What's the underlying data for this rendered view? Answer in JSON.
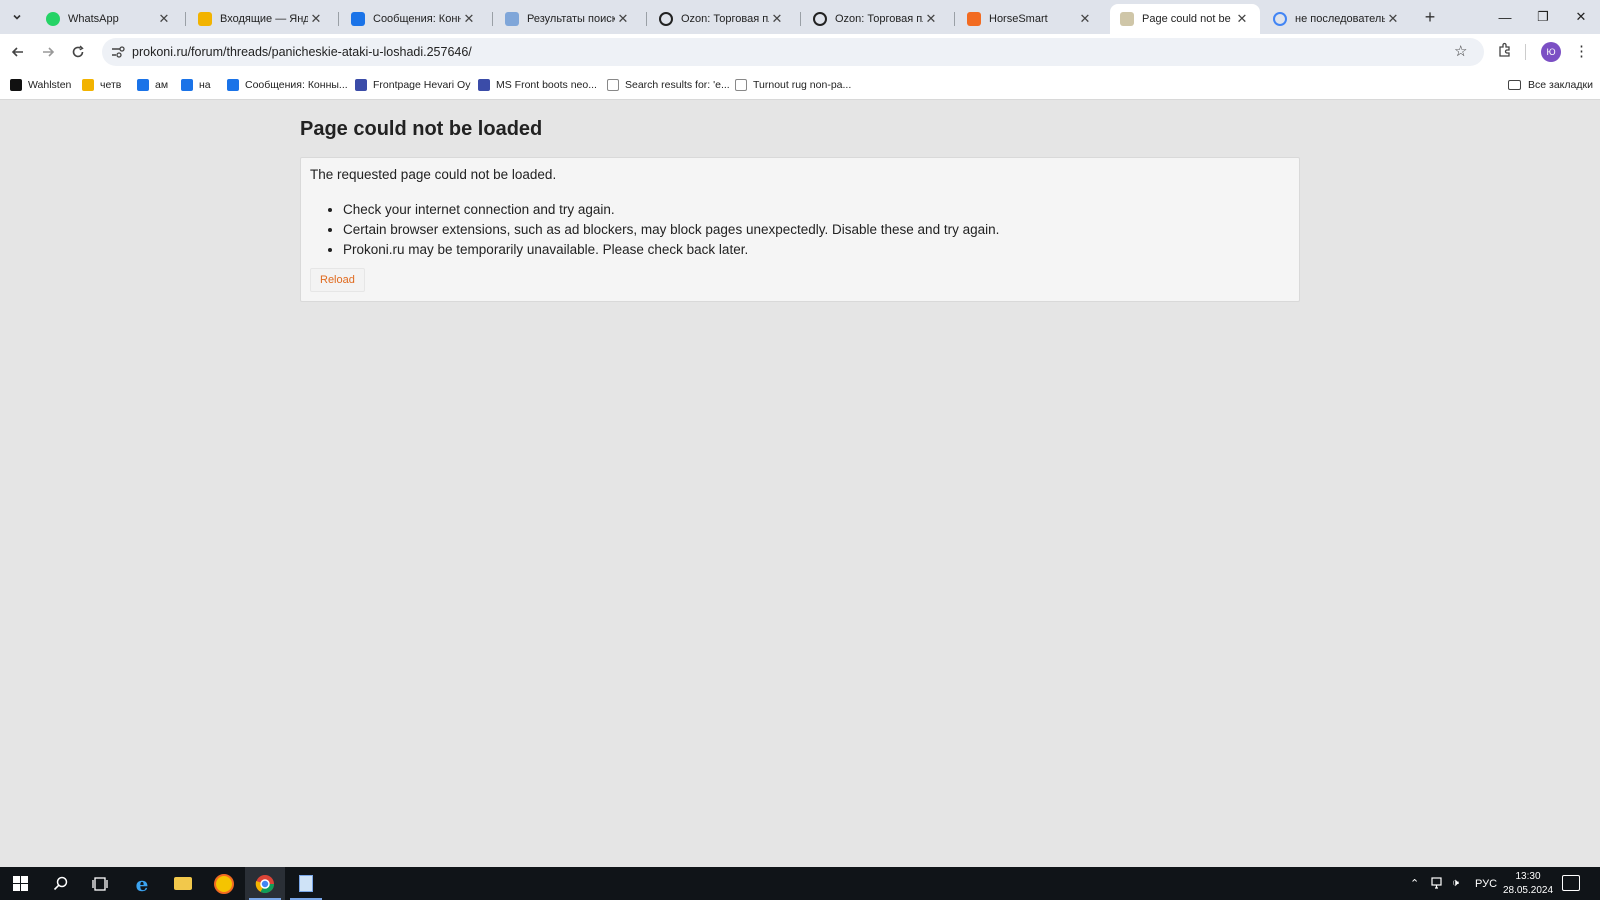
{
  "browser": {
    "tabs": [
      {
        "title": "WhatsApp",
        "favicon": "whatsapp-icon",
        "color": "#25d366",
        "active": false
      },
      {
        "title": "Входящие — Яндекс",
        "favicon": "yandex-mail-icon",
        "color": "#f2b300",
        "active": false
      },
      {
        "title": "Сообщения: Конный",
        "favicon": "chat-icon",
        "color": "#1a73e8",
        "active": false
      },
      {
        "title": "Результаты поиска",
        "favicon": "search-results-icon",
        "color": "#7fa6d9",
        "active": false
      },
      {
        "title": "Ozon: Торговая пло",
        "favicon": "ozon-icon",
        "color": "#222222",
        "active": false
      },
      {
        "title": "Ozon: Торговая пло",
        "favicon": "ozon-icon",
        "color": "#222222",
        "active": false
      },
      {
        "title": "HorseSmart",
        "favicon": "horsesmart-icon",
        "color": "#f26b21",
        "active": false
      },
      {
        "title": "Page could not be lo",
        "favicon": "horse-icon",
        "color": "#555555",
        "active": true
      },
      {
        "title": "не последовательно",
        "favicon": "google-icon",
        "color": "#4285f4",
        "active": false
      }
    ],
    "new_tab_label": "+",
    "window_controls": {
      "minimize": "—",
      "restore": "❐",
      "close": "✕"
    },
    "address": "prokoni.ru/forum/threads/panicheskie-ataki-u-loshadi.257646/",
    "profile_initials": "Ю"
  },
  "bookmarks": {
    "items": [
      {
        "label": "Wahlsten",
        "color": "#111111"
      },
      {
        "label": "четв",
        "color": "#f2b300"
      },
      {
        "label": "ам",
        "color": "#1a73e8"
      },
      {
        "label": "на",
        "color": "#1a73e8"
      },
      {
        "label": "Сообщения: Конны...",
        "color": "#1a73e8"
      },
      {
        "label": "Frontpage Hevari Oy",
        "color": "#3b4ca8"
      },
      {
        "label": "MS Front boots neo...",
        "color": "#3b4ca8"
      },
      {
        "label": "Search results for: 'e...",
        "color": "#888888"
      },
      {
        "label": "Turnout rug non-pa...",
        "color": "#888888"
      }
    ],
    "all_bookmarks": "Все закладки"
  },
  "page": {
    "title": "Page could not be loaded",
    "intro": "The requested page could not be loaded.",
    "reasons": [
      "Check your internet connection and try again.",
      "Certain browser extensions, such as ad blockers, may block pages unexpectedly. Disable these and try again.",
      "Prokoni.ru may be temporarily unavailable. Please check back later."
    ],
    "reload_label": "Reload",
    "accent_color": "#e06a1e"
  },
  "taskbar": {
    "language": "РУС",
    "time": "13:30",
    "date": "28.05.2024"
  }
}
